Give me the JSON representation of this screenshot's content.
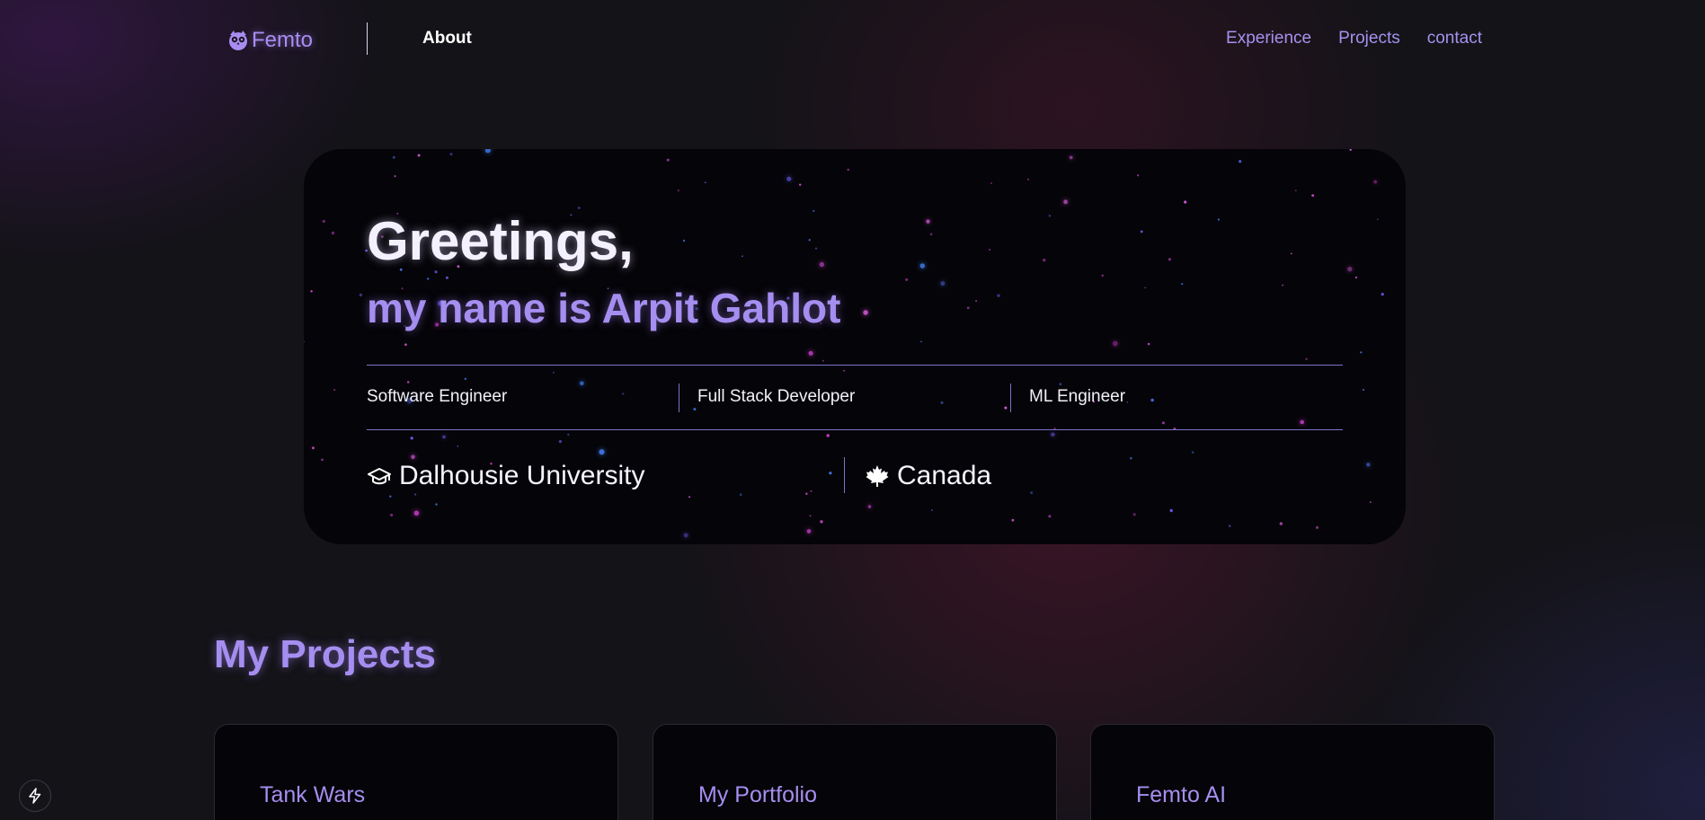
{
  "nav": {
    "brand": "Femto",
    "brand_icon": "owl-icon",
    "about": "About",
    "links": [
      "Experience",
      "Projects",
      "contact"
    ]
  },
  "hero": {
    "greeting": "Greetings,",
    "name_line": "my name is Arpit Gahlot",
    "roles": [
      "Software Engineer",
      "Full Stack Developer",
      "ML Engineer"
    ],
    "university": "Dalhousie University",
    "university_icon": "graduation-cap-icon",
    "country": "Canada",
    "country_icon": "maple-leaf-icon"
  },
  "projects": {
    "title": "My Projects",
    "cards": [
      {
        "title": "Tank Wars"
      },
      {
        "title": "My Portfolio"
      },
      {
        "title": "Femto AI"
      }
    ]
  },
  "badge_icon": "lightning-bolt-icon",
  "colors": {
    "accent": "#a58ef0",
    "background": "#141318",
    "card": "#050408",
    "rule": "#7d72c9"
  }
}
